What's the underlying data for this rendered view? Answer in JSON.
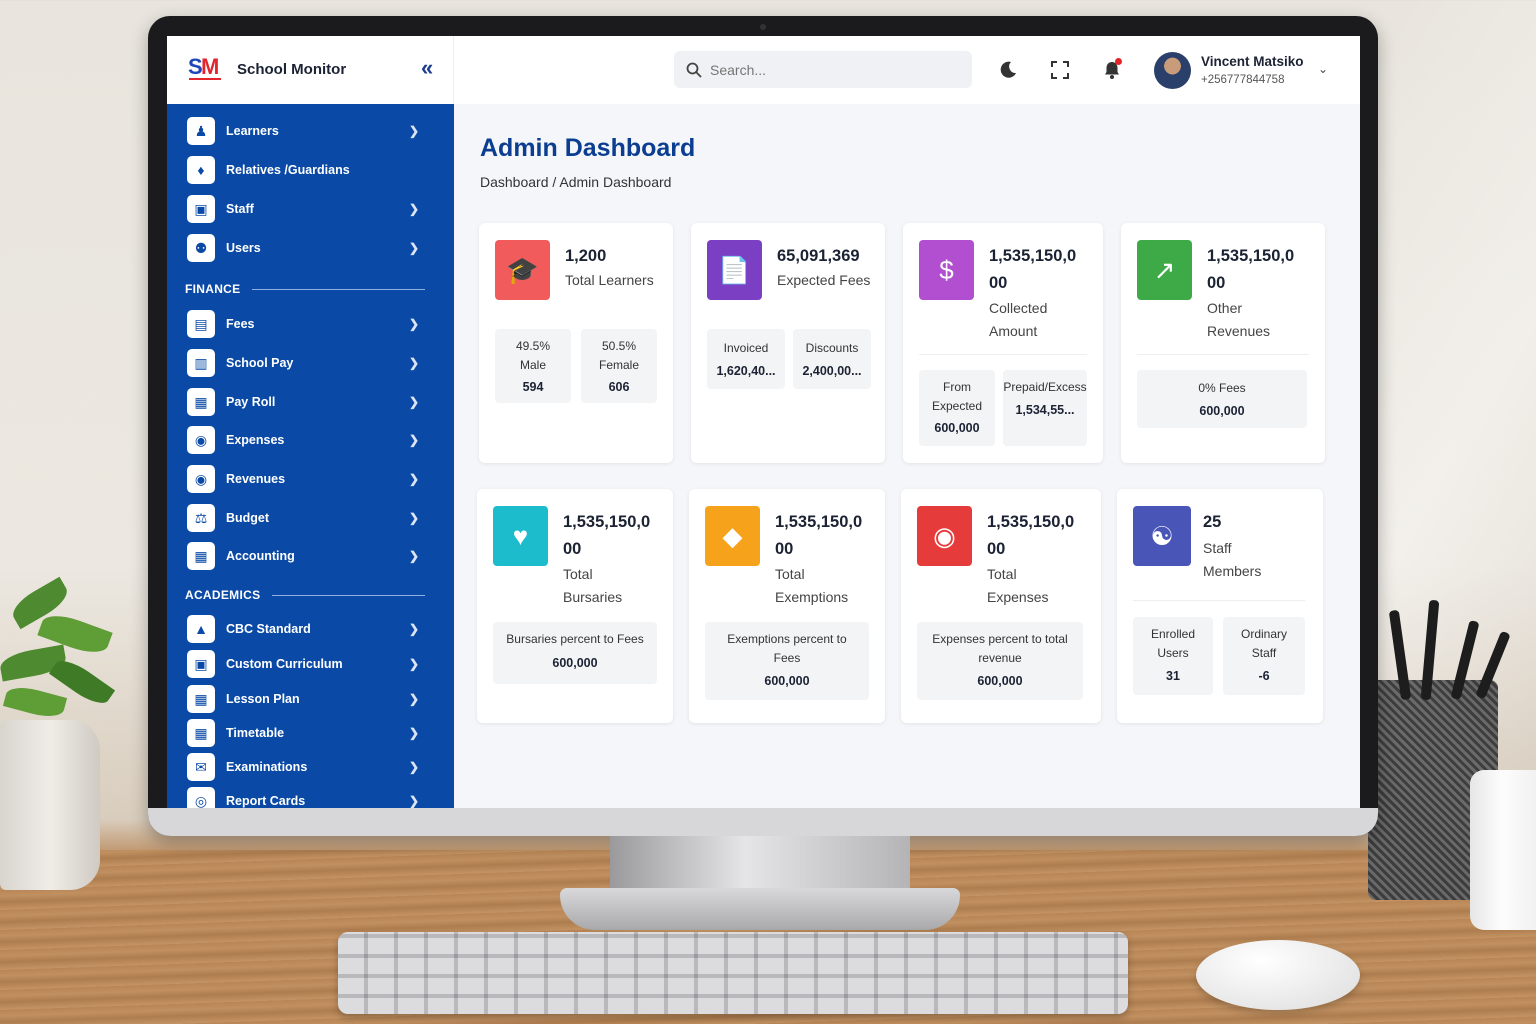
{
  "brand": {
    "logo_text": "SM",
    "name": "School Monitor",
    "collapse": "«"
  },
  "search": {
    "placeholder": "Search..."
  },
  "user": {
    "name": "Vincent Matsiko",
    "phone": "+256777844758"
  },
  "nav": {
    "top": [
      {
        "label": "Learners",
        "icon": "graduate-icon"
      },
      {
        "label": "Relatives /Guardians",
        "icon": "family-icon"
      },
      {
        "label": "Staff",
        "icon": "staff-icon"
      },
      {
        "label": "Users",
        "icon": "users-icon"
      }
    ],
    "finance_title": "FINANCE",
    "finance": [
      {
        "label": "Fees",
        "icon": "money-icon"
      },
      {
        "label": "School Pay",
        "icon": "wallet-icon"
      },
      {
        "label": "Pay Roll",
        "icon": "payroll-icon"
      },
      {
        "label": "Expenses",
        "icon": "moneybag-icon"
      },
      {
        "label": "Revenues",
        "icon": "moneybag-icon"
      },
      {
        "label": "Budget",
        "icon": "scale-icon"
      },
      {
        "label": "Accounting",
        "icon": "calculator-icon"
      }
    ],
    "academics_title": "ACADEMICS",
    "academics": [
      {
        "label": "CBC Standard",
        "icon": "cap-icon"
      },
      {
        "label": "Custom Curriculum",
        "icon": "book-icon"
      },
      {
        "label": "Lesson Plan",
        "icon": "calendar-icon"
      },
      {
        "label": "Timetable",
        "icon": "calendar-icon"
      },
      {
        "label": "Examinations",
        "icon": "exam-icon"
      },
      {
        "label": "Report Cards",
        "icon": "report-icon"
      }
    ]
  },
  "page": {
    "title": "Admin Dashboard",
    "breadcrumb": "Dashboard / Admin Dashboard"
  },
  "cards": {
    "learners": {
      "value": "1,200",
      "label": "Total Learners",
      "male_pct": "49.5%",
      "male_label": "Male",
      "male_val": "594",
      "female_pct": "50.5%",
      "female_label": "Female",
      "female_val": "606",
      "color": "#f15b5b"
    },
    "expected": {
      "value": "65,091,369",
      "label": "Expected Fees",
      "invoiced_label": "Invoiced",
      "invoiced_val": "1,620,40...",
      "discounts_label": "Discounts",
      "discounts_val": "2,400,00...",
      "color": "#7b3fc4"
    },
    "collected": {
      "value_1": "1,535,150,0",
      "value_2": "00",
      "label_1": "Collected",
      "label_2": "Amount",
      "from_label_1": "From",
      "from_label_2": "Expected",
      "from_val": "600,000",
      "prepaid_label": "Prepaid/Excess",
      "prepaid_val": "1,534,55...",
      "color": "#b14fd0"
    },
    "other": {
      "value_1": "1,535,150,0",
      "value_2": "00",
      "label_1": "Other",
      "label_2": "Revenues",
      "fees_label": "0% Fees",
      "fees_val": "600,000",
      "color": "#3daa47"
    },
    "bursaries": {
      "value_1": "1,535,150,0",
      "value_2": "00",
      "label_1": "Total",
      "label_2": "Bursaries",
      "sub_label": "Bursaries percent to Fees",
      "sub_val": "600,000",
      "color": "#1cbccc"
    },
    "exemptions": {
      "value_1": "1,535,150,0",
      "value_2": "00",
      "label_1": "Total",
      "label_2": "Exemptions",
      "sub_label_1": "Exemptions percent to",
      "sub_label_2": "Fees",
      "sub_val": "600,000",
      "color": "#f7a21b"
    },
    "expenses": {
      "value_1": "1,535,150,0",
      "value_2": "00",
      "label_1": "Total",
      "label_2": "Expenses",
      "sub_label_1": "Expenses percent to total",
      "sub_label_2": "revenue",
      "sub_val": "600,000",
      "color": "#e63b3b"
    },
    "staff": {
      "value": "25",
      "label_1": "Staff",
      "label_2": "Members",
      "enrolled_1": "Enrolled",
      "enrolled_2": "Users",
      "enrolled_val": "31",
      "ordinary_1": "Ordinary",
      "ordinary_2": "Staff",
      "ordinary_val": "-6",
      "color": "#4a55b8"
    }
  }
}
